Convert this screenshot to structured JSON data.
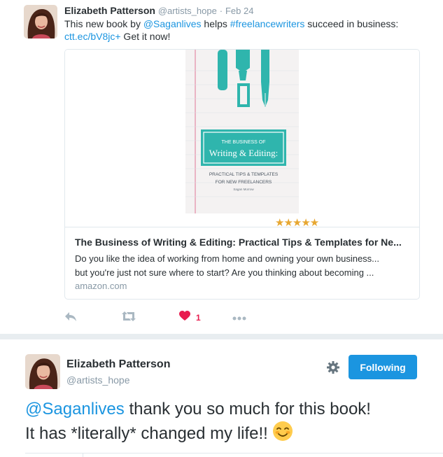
{
  "tweet1": {
    "author_name": "Elizabeth Patterson",
    "author_handle": "@artists_hope",
    "separator": "·",
    "date": "Feb 24",
    "text_before": "This new book by ",
    "mention": "@Saganlives",
    "text_middle": " helps ",
    "hashtag": "#freelancewriters",
    "text_after": " succeed in business: ",
    "link": "ctt.ec/bV8jc+",
    "text_end": " Get it now!",
    "card": {
      "book_cover": {
        "line1": "THE BUSINESS OF",
        "line2": "Writing & Editing:",
        "line3": "PRACTICAL TIPS & TEMPLATES",
        "line4": "FOR NEW FREELANCERS",
        "author": "Sagan Morrow"
      },
      "rating_stars": "★★★★★",
      "title": "The Business of Writing & Editing: Practical Tips & Templates for Ne...",
      "description_line1": "Do you like the idea of working from home and owning your own business...",
      "description_line2": "but you're just not sure where to start? Are you thinking about becoming ...",
      "domain": "amazon.com"
    },
    "actions": {
      "reply_icon": "reply-icon",
      "retweet_icon": "retweet-icon",
      "like_icon": "heart-icon",
      "like_count": "1",
      "more_icon": "more-dots-icon"
    }
  },
  "tweet2": {
    "author_name": "Elizabeth Patterson",
    "author_handle": "@artists_hope",
    "settings_icon": "gear-icon",
    "follow_label": "Following",
    "mention": "@Saganlives",
    "text_line1": " thank you so much for this book!",
    "text_line2": "It has *literally* changed my life!!",
    "emoji": "smiling-face-emoji"
  },
  "colors": {
    "accent": "#1b95e0",
    "like": "#e81c4f",
    "muted": "#8899a6",
    "book_teal": "#2fb5ad",
    "divider": "#e8edf0"
  }
}
